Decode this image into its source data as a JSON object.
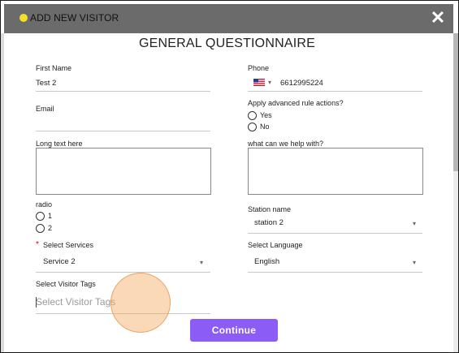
{
  "modal": {
    "title": "ADD NEW VISITOR",
    "close_label": "✕",
    "heading": "GENERAL QUESTIONNAIRE",
    "continue_label": "Continue"
  },
  "form": {
    "first_name": {
      "label": "First Name",
      "value": "Test 2"
    },
    "phone": {
      "label": "Phone",
      "country_caret": "▾",
      "value": "6612995224"
    },
    "email": {
      "label": "Email",
      "value": ""
    },
    "advanced": {
      "label": "Apply advanced rule actions?",
      "options": [
        "Yes",
        "No"
      ]
    },
    "long_text": {
      "label": "Long text here",
      "value": ""
    },
    "help": {
      "label": "what can we help with?",
      "value": ""
    },
    "radio": {
      "label": "radio",
      "options": [
        "1",
        "2"
      ]
    },
    "station": {
      "label": "Station name",
      "value": "station 2"
    },
    "services": {
      "required_mark": "*",
      "label": "Select Services",
      "value": "Service 2"
    },
    "language": {
      "label": "Select Language",
      "value": "English"
    },
    "tags": {
      "label": "Select Visitor Tags",
      "placeholder": "Select Visitor Tags"
    }
  },
  "icons": {
    "status_dot": "#f3df2a",
    "close": "close-icon",
    "flag": "us-flag-icon",
    "dropdown": "▾"
  },
  "colors": {
    "titlebar": "#6b6b6b",
    "accent": "#8b5cf6",
    "required": "#d0021b"
  }
}
